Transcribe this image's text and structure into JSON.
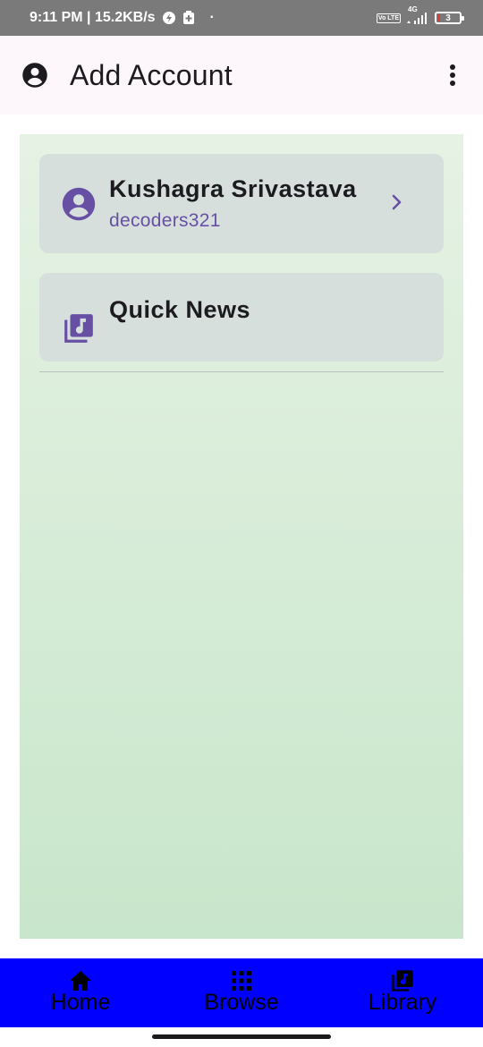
{
  "status_bar": {
    "time_speed": "9:11 PM | 15.2KB/s",
    "dot": "·",
    "volte": "Vo LTE",
    "network": "4G",
    "battery": "3"
  },
  "app_bar": {
    "title": "Add Account",
    "leading_icon": "account-circle-icon",
    "menu_icon": "more-vert-icon"
  },
  "accounts": [
    {
      "name": "Kushagra Srivastava",
      "username": "decoders321",
      "icon": "account-circle-icon",
      "trailing_icon": "chevron-right-icon"
    }
  ],
  "quick_news": {
    "label": "Quick News",
    "icon": "library-music-icon"
  },
  "bottom_nav": {
    "items": [
      {
        "label": "Home",
        "icon": "home-icon"
      },
      {
        "label": "Browse",
        "icon": "grid-icon"
      },
      {
        "label": "Library",
        "icon": "library-music-icon"
      }
    ]
  },
  "colors": {
    "accent": "#6750a4",
    "app_bar_bg": "#fdf6fb",
    "card_bg": "#d7dfdc",
    "nav_bg": "#0000ff",
    "status_bar_bg": "#7a7a7a"
  }
}
